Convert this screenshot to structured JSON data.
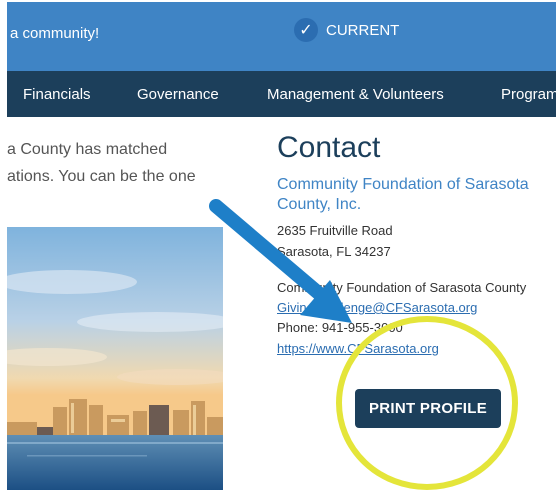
{
  "topbar": {
    "tagline": "a community!",
    "badge_label": "CURRENT",
    "check_glyph": "✓"
  },
  "nav": {
    "items": [
      "Financials",
      "Governance",
      "Management & Volunteers",
      "Program"
    ]
  },
  "intro": {
    "line1": "a County has matched",
    "line2": "ations. You can be the one"
  },
  "contact": {
    "heading": "Contact",
    "org_name": "Community Foundation of Sarasota County, Inc.",
    "address_line1": "2635 Fruitville Road",
    "address_line2": "Sarasota, FL 34237",
    "contact_name": "Community Foundation of Sarasota County",
    "email": "GivingChallenge@CFSarasota.org",
    "phone": "Phone: 941-955-3000",
    "website": "https://www.CFSarasota.org",
    "print_label": "PRINT PROFILE"
  },
  "colors": {
    "topbar": "#3f84c5",
    "navbar": "#1c3f5b",
    "link": "#2b6db1",
    "arrow": "#1e7fc8",
    "highlight_circle": "#e4e53a"
  },
  "icons": {
    "badge": "check-circle-icon",
    "annotation_arrow": "arrow-icon",
    "annotation_circle": "highlight-circle"
  }
}
